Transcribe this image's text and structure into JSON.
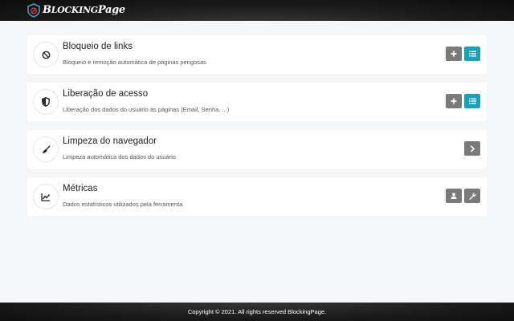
{
  "header": {
    "brand_prefix": "B",
    "brand_middle": "LOCKING",
    "brand_suffix": "Page"
  },
  "cards": [
    {
      "title": "Bloqueio de links",
      "description": "Bloqueio e remoção automática de páginas perigosas",
      "icon": "block-icon",
      "buttons": [
        "add-icon",
        "list-icon"
      ]
    },
    {
      "title": "Liberação de acesso",
      "description": "Liberação dos dados do usuário às páginas (Email, Senha, ...)",
      "icon": "shield-icon",
      "buttons": [
        "add-icon",
        "list-icon"
      ]
    },
    {
      "title": "Limpeza do navegador",
      "description": "Limpeza automática dos dados do usuário",
      "icon": "broom-icon",
      "buttons": [
        "chevron-right-icon"
      ]
    },
    {
      "title": "Métricas",
      "description": "Dados estatísticos utilizados pela ferramenta",
      "icon": "chart-icon",
      "buttons": [
        "user-icon",
        "wrench-icon"
      ]
    }
  ],
  "footer": {
    "text": "Copyright © 2021. All rights reserved BlockingPage."
  },
  "colors": {
    "accent": "#17a2b8",
    "button_grey": "#7a7a7a",
    "background": "#f5f6f8",
    "bar": "#1b1b1b"
  }
}
